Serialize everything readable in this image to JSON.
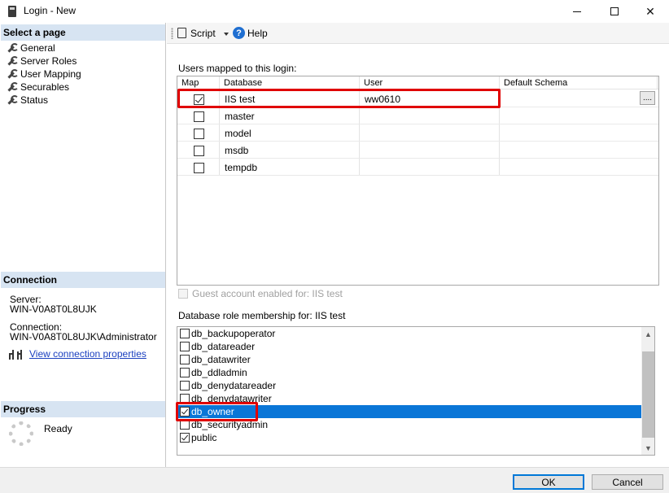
{
  "window": {
    "title": "Login - New",
    "minimize_label": "–",
    "close_label": "✕"
  },
  "left": {
    "select_page_header": "Select a page",
    "nav_items": [
      {
        "label": "General"
      },
      {
        "label": "Server Roles"
      },
      {
        "label": "User Mapping"
      },
      {
        "label": "Securables"
      },
      {
        "label": "Status"
      }
    ],
    "connection_header": "Connection",
    "server_label": "Server:",
    "server_value": "WIN-V0A8T0L8UJK",
    "connection_label": "Connection:",
    "connection_value": "WIN-V0A8T0L8UJK\\Administrator",
    "view_properties_link": "View connection properties",
    "progress_header": "Progress",
    "progress_status": "Ready"
  },
  "toolbar": {
    "script_label": "Script",
    "help_label": "Help"
  },
  "mapping": {
    "caption": "Users mapped to this login:",
    "columns": [
      "Map",
      "Database",
      "User",
      "Default Schema"
    ],
    "rows": [
      {
        "map": true,
        "database": "IIS test",
        "user": "ww0610",
        "schema": ""
      },
      {
        "map": false,
        "database": "master",
        "user": "",
        "schema": ""
      },
      {
        "map": false,
        "database": "model",
        "user": "",
        "schema": ""
      },
      {
        "map": false,
        "database": "msdb",
        "user": "",
        "schema": ""
      },
      {
        "map": false,
        "database": "tempdb",
        "user": "",
        "schema": ""
      }
    ],
    "ellipsis_label": "...."
  },
  "guest": {
    "label": "Guest account enabled for: IIS test",
    "checked": false,
    "enabled": false
  },
  "roles": {
    "caption": "Database role membership for: IIS test",
    "items": [
      {
        "label": "db_backupoperator",
        "checked": false,
        "selected": false
      },
      {
        "label": "db_datareader",
        "checked": false,
        "selected": false
      },
      {
        "label": "db_datawriter",
        "checked": false,
        "selected": false
      },
      {
        "label": "db_ddladmin",
        "checked": false,
        "selected": false
      },
      {
        "label": "db_denydatareader",
        "checked": false,
        "selected": false
      },
      {
        "label": "db_denydatawriter",
        "checked": false,
        "selected": false
      },
      {
        "label": "db_owner",
        "checked": true,
        "selected": true
      },
      {
        "label": "db_securityadmin",
        "checked": false,
        "selected": false
      },
      {
        "label": "public",
        "checked": true,
        "selected": false
      }
    ]
  },
  "buttons": {
    "ok_label": "OK",
    "cancel_label": "Cancel"
  },
  "colors": {
    "highlight": "#0a76d7",
    "annotation_red": "#e00000",
    "header_blue": "#d7e4f2",
    "link_blue": "#1a3fbf"
  }
}
